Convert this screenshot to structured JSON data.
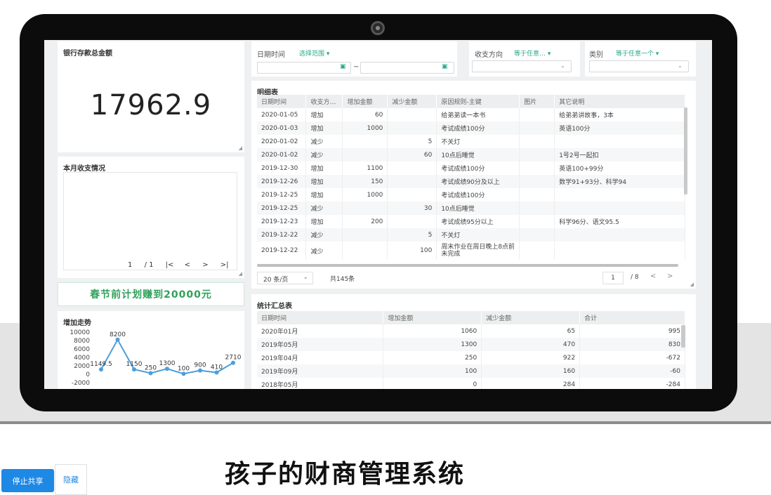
{
  "left": {
    "bank_title": "银行存款总金额",
    "bank_total": "17962.9",
    "monthly_title": "本月收支情况",
    "pager": {
      "page": "1",
      "total": "/ 1"
    },
    "banner": "春节前计划赚到20000元",
    "trend_title": "增加走势"
  },
  "filters": {
    "date_label": "日期时间",
    "date_select": "选择范围",
    "date_sep": "~",
    "direction_label": "收支方向",
    "direction_select": "等于任意…",
    "category_label": "类别",
    "category_select": "等于任意一个"
  },
  "detail": {
    "title": "明细表",
    "columns": [
      "日期时间",
      "收支方…",
      "增加金额",
      "减少金额",
      "原因规则-主键",
      "图片",
      "其它说明"
    ],
    "rows": [
      [
        "2020-01-05",
        "增加",
        "60",
        "",
        "给弟弟读一本书",
        "",
        "给弟弟讲故事，3本"
      ],
      [
        "2020-01-03",
        "增加",
        "1000",
        "",
        "考试成绩100分",
        "",
        "英语100分"
      ],
      [
        "2020-01-02",
        "减少",
        "",
        "5",
        "不关灯",
        "",
        ""
      ],
      [
        "2020-01-02",
        "减少",
        "",
        "60",
        "10点后睡觉",
        "",
        "1号2号一起扣"
      ],
      [
        "2019-12-30",
        "增加",
        "1100",
        "",
        "考试成绩100分",
        "",
        "英语100+99分"
      ],
      [
        "2019-12-26",
        "增加",
        "150",
        "",
        "考试成绩90分及以上",
        "",
        "数学91+93分、科学94"
      ],
      [
        "2019-12-25",
        "增加",
        "1000",
        "",
        "考试成绩100分",
        "",
        ""
      ],
      [
        "2019-12-25",
        "减少",
        "",
        "30",
        "10点后睡觉",
        "",
        ""
      ],
      [
        "2019-12-23",
        "增加",
        "200",
        "",
        "考试成绩95分以上",
        "",
        "科学96分、语文95.5"
      ],
      [
        "2019-12-22",
        "减少",
        "",
        "5",
        "不关灯",
        "",
        ""
      ],
      [
        "2019-12-22",
        "减少",
        "",
        "100",
        "周末作业在周日晚上8点前未完成",
        "",
        ""
      ]
    ],
    "page_size": "20 条/页",
    "total": "共145条",
    "page": "1",
    "page_total": "/ 8"
  },
  "summary": {
    "title": "统计汇总表",
    "columns": [
      "日期时间",
      "增加金额",
      "减少金额",
      "合计"
    ],
    "rows": [
      [
        "2020年01月",
        "1060",
        "65",
        "995"
      ],
      [
        "2019年05月",
        "1300",
        "470",
        "830"
      ],
      [
        "2019年04月",
        "250",
        "922",
        "-672"
      ],
      [
        "2019年09月",
        "100",
        "160",
        "-60"
      ],
      [
        "2018年05月",
        "0",
        "284",
        "-284"
      ]
    ]
  },
  "chart_data": {
    "type": "line",
    "title": "增加走势",
    "y_ticks": [
      "10000",
      "8000",
      "6000",
      "4000",
      "2000",
      "0",
      "-2000"
    ],
    "ylim": [
      -2000,
      10000
    ],
    "values": [
      1149.5,
      8200,
      1150,
      250,
      1300,
      100,
      900,
      410,
      2710
    ],
    "point_labels": [
      "1149.5",
      "8200",
      "1150",
      "250",
      "1300",
      "100",
      "900",
      "410",
      "2710"
    ],
    "color": "#4a9fdc"
  },
  "bottom": {
    "stop_share": "停止共享",
    "hide": "隐藏",
    "caption": "孩子的财商管理系统"
  }
}
